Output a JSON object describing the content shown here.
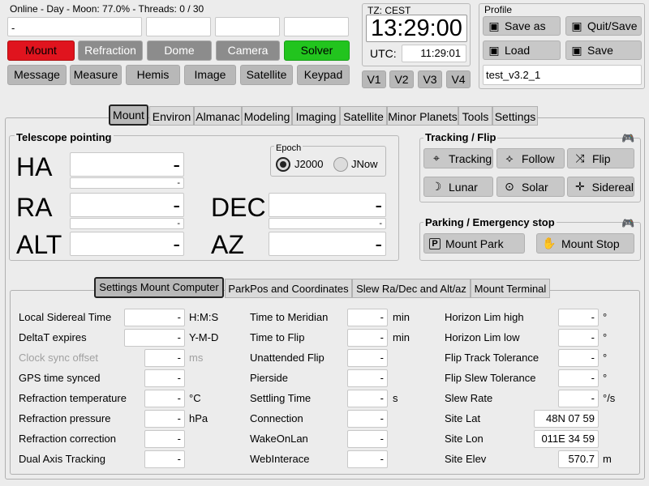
{
  "status_line": "Online - Day - Moon: 77.0% - Threads: 0 / 30",
  "top_input_value": "-",
  "top_boxes": [
    "",
    "",
    "",
    ""
  ],
  "status_buttons": {
    "mount": "Mount",
    "refraction": "Refraction",
    "dome": "Dome",
    "camera": "Camera",
    "solver": "Solver"
  },
  "action_buttons": [
    "Message",
    "Measure",
    "Hemis",
    "Image",
    "Satellite",
    "Keypad"
  ],
  "time": {
    "tz": "TZ: CEST",
    "local_time": "13:29:00",
    "utc_label": "UTC:",
    "utc_time": "11:29:01",
    "v_buttons": [
      "V1",
      "V2",
      "V3",
      "V4"
    ]
  },
  "profile": {
    "title": "Profile",
    "save_as": "Save as",
    "quit_save": "Quit/Save",
    "load": "Load",
    "save": "Save",
    "name": "test_v3.2_1"
  },
  "main_tabs": [
    "Mount",
    "Environ",
    "Almanac",
    "Modeling",
    "Imaging",
    "Satellite",
    "Minor Planets",
    "Tools",
    "Settings"
  ],
  "pointing": {
    "title": "Telescope pointing",
    "ha_label": "HA",
    "ha_value": "-",
    "ha_sub": "-",
    "ra_label": "RA",
    "ra_value": "-",
    "ra_sub": "-",
    "dec_label": "DEC",
    "dec_value": "-",
    "dec_sub": "-",
    "alt_label": "ALT",
    "alt_value": "-",
    "az_label": "AZ",
    "az_value": "-",
    "epoch_title": "Epoch",
    "j2000": "J2000",
    "jnow": "JNow"
  },
  "tracking": {
    "title": "Tracking / Flip",
    "tracking": "Tracking",
    "follow": "Follow",
    "flip": "Flip",
    "lunar": "Lunar",
    "solar": "Solar",
    "sidereal": "Sidereal"
  },
  "parking": {
    "title": "Parking / Emergency stop",
    "park": "Mount Park",
    "stop": "Mount Stop"
  },
  "sub_tabs": [
    "Settings Mount Computer",
    "ParkPos and Coordinates",
    "Slew Ra/Dec and Alt/az",
    "Mount Terminal"
  ],
  "settings_col1": [
    {
      "label": "Local Sidereal Time",
      "value": "-",
      "unit": "H:M:S",
      "wide": true,
      "disabled": false
    },
    {
      "label": "DeltaT expires",
      "value": "-",
      "unit": "Y-M-D",
      "wide": true,
      "disabled": false
    },
    {
      "label": "Clock sync offset",
      "value": "-",
      "unit": "ms",
      "wide": false,
      "disabled": true
    },
    {
      "label": "GPS time synced",
      "value": "-",
      "unit": "",
      "wide": false,
      "disabled": false
    },
    {
      "label": "Refraction temperature",
      "value": "-",
      "unit": "°C",
      "wide": false,
      "disabled": false
    },
    {
      "label": "Refraction pressure",
      "value": "-",
      "unit": "hPa",
      "wide": false,
      "disabled": false
    },
    {
      "label": "Refraction correction",
      "value": "-",
      "unit": "",
      "wide": false,
      "disabled": false
    },
    {
      "label": "Dual Axis Tracking",
      "value": "-",
      "unit": "",
      "wide": false,
      "disabled": false
    }
  ],
  "settings_col2": [
    {
      "label": "Time to Meridian",
      "value": "-",
      "unit": "min"
    },
    {
      "label": "Time to Flip",
      "value": "-",
      "unit": "min"
    },
    {
      "label": "Unattended Flip",
      "value": "-",
      "unit": ""
    },
    {
      "label": "Pierside",
      "value": "-",
      "unit": ""
    },
    {
      "label": "Settling Time",
      "value": "-",
      "unit": "s"
    },
    {
      "label": "Connection",
      "value": "-",
      "unit": ""
    },
    {
      "label": "WakeOnLan",
      "value": "-",
      "unit": ""
    },
    {
      "label": "WebInterace",
      "value": "-",
      "unit": ""
    }
  ],
  "settings_col3": [
    {
      "label": "Horizon Lim high",
      "value": "-",
      "unit": "°"
    },
    {
      "label": "Horizon Lim low",
      "value": "-",
      "unit": "°"
    },
    {
      "label": "Flip Track Tolerance",
      "value": "-",
      "unit": "°"
    },
    {
      "label": "Flip Slew Tolerance",
      "value": "-",
      "unit": "°"
    },
    {
      "label": "Slew Rate",
      "value": "-",
      "unit": "°/s"
    },
    {
      "label": "Site Lat",
      "value": "48N 07 59",
      "unit": ""
    },
    {
      "label": "Site Lon",
      "value": "011E 34 59",
      "unit": ""
    },
    {
      "label": "Site Elev",
      "value": "570.7",
      "unit": "m"
    }
  ],
  "colors": {
    "mount_btn": "#e0141e",
    "solver_btn": "#22c41e",
    "gray_btn": "#8c8c8c"
  }
}
